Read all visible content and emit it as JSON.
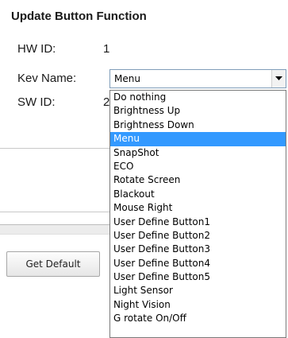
{
  "panel": {
    "title": "Update Button Function"
  },
  "fields": {
    "hw_id_label": "HW ID:",
    "hw_id_value": "1",
    "key_name_label": "Kev Name:",
    "sw_id_label": "SW ID:",
    "sw_id_value": "2"
  },
  "key_name_select": {
    "value": "Menu",
    "selected_index": 3,
    "options": [
      "Do nothing",
      "Brightness Up",
      "Brightness Down",
      "Menu",
      "SnapShot",
      "ECO",
      "Rotate Screen",
      "Blackout",
      "Mouse Right",
      "User Define Button1",
      "User Define Button2",
      "User Define Button3",
      "User Define Button4",
      "User Define Button5",
      "Light Sensor",
      "Night Vision",
      "G rotate On/Off"
    ]
  },
  "buttons": {
    "get_default_label": "Get Default"
  },
  "colors": {
    "selection": "#3399ff",
    "select_border": "#7f9db9"
  },
  "icons": {
    "select_arrow": "chevron-down-icon"
  }
}
